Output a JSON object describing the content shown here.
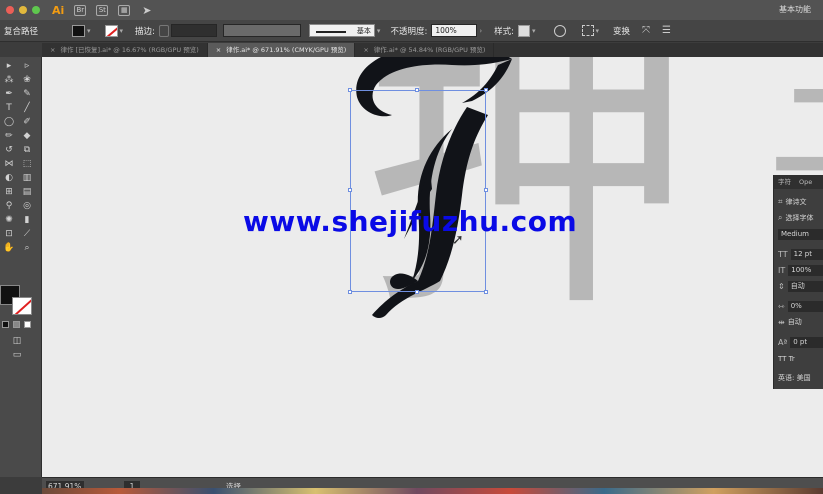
{
  "menubar": {
    "app_logo": "Ai",
    "icons": [
      "bridge-icon",
      "stock-icon",
      "arrange-icon",
      "gpu-arrow-icon"
    ],
    "workspace": "基本功能"
  },
  "controlbar": {
    "object_type": "复合路径",
    "stroke_label": "描边:",
    "brush_label": "基本",
    "opacity_label": "不透明度:",
    "opacity_value": "100%",
    "style_label": "样式:",
    "transform_label": "变换"
  },
  "tabs": [
    {
      "label": "律作 [已恢复].ai* @ 16.67% (RGB/GPU 预览)",
      "active": false
    },
    {
      "label": "律作.ai* @ 671.91% (CMYK/GPU 预览)",
      "active": true
    },
    {
      "label": "律作.ai* @ 54.84% (RGB/GPU 预览)",
      "active": false
    }
  ],
  "tab_close": "×",
  "canvas": {
    "ghost_text": "押",
    "ghost_text_2": "子",
    "watermark": "www.shejifuzhu.com",
    "colors": {
      "glyph": "#111318",
      "ghost": "#b7b7b7",
      "selection": "#6f8fe0",
      "watermark": "#0a0ae6"
    }
  },
  "panel": {
    "tabs": [
      "字符",
      "Ope"
    ],
    "font_family": "律诗文",
    "font_search": "选择字体",
    "font_style": "Medium",
    "font_size": "12 pt",
    "scale": "100%",
    "leading": "自动",
    "kerning": "0%",
    "tracking": "自动",
    "baseline": "0 pt",
    "case_buttons": "TT  Tr",
    "language": "英语: 美国"
  },
  "statusbar": {
    "zoom": "671.91%",
    "page": "1",
    "tool_name": "选择"
  }
}
